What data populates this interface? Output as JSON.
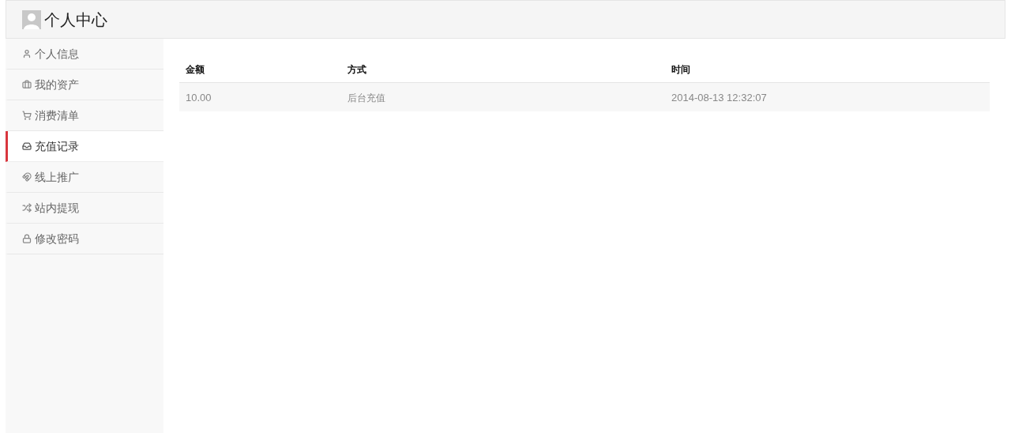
{
  "header": {
    "title": "个人中心"
  },
  "sidebar": {
    "items": [
      {
        "label": "个人信息",
        "selected": false
      },
      {
        "label": "我的资产",
        "selected": false
      },
      {
        "label": "消费清单",
        "selected": false
      },
      {
        "label": "充值记录",
        "selected": true
      },
      {
        "label": "线上推广",
        "selected": false
      },
      {
        "label": "站内提现",
        "selected": false
      },
      {
        "label": "修改密码",
        "selected": false
      }
    ]
  },
  "table": {
    "columns": [
      "金额",
      "方式",
      "时间"
    ],
    "rows": [
      [
        "10.00",
        "后台充值",
        "2014-08-13 12:32:07"
      ]
    ]
  }
}
